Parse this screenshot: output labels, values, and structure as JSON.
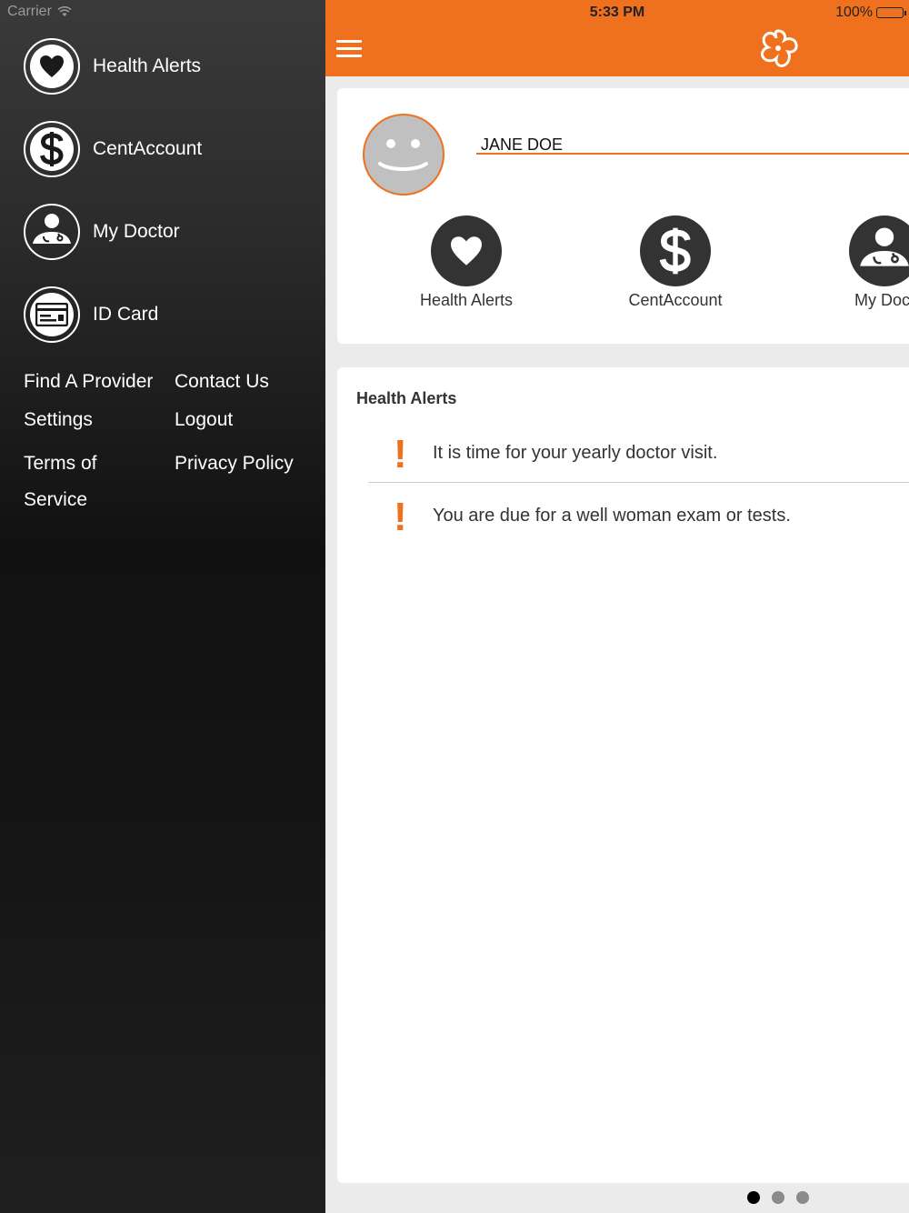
{
  "status_bar": {
    "carrier": "Carrier",
    "time": "5:33 PM",
    "battery": "100%"
  },
  "sidebar": {
    "items": [
      {
        "label": "Health Alerts",
        "icon": "heart-icon"
      },
      {
        "label": "CentAccount",
        "icon": "dollar-icon"
      },
      {
        "label": "My Doctor",
        "icon": "doctor-icon"
      },
      {
        "label": "ID Card",
        "icon": "id-card-icon"
      }
    ],
    "links": {
      "find_provider": "Find A Provider",
      "contact_us": "Contact Us",
      "settings": "Settings",
      "logout": "Logout",
      "terms_line1": "Terms of",
      "terms_line2": "Service",
      "privacy": "Privacy Policy"
    }
  },
  "header": {
    "menu_icon": "hamburger-icon",
    "logo_icon": "flower-logo-icon",
    "accent": "#f0711d"
  },
  "profile": {
    "name": "JANE DOE",
    "quick_actions": [
      {
        "label": "Health Alerts",
        "icon": "heart-icon"
      },
      {
        "label": "CentAccount",
        "icon": "dollar-icon"
      },
      {
        "label": "My Doct",
        "icon": "doctor-icon"
      }
    ]
  },
  "alerts": {
    "title": "Health Alerts",
    "items": [
      {
        "text": "It is time for your yearly doctor visit."
      },
      {
        "text": "You are due for a well woman exam or tests."
      }
    ]
  },
  "pager": {
    "pages": 3,
    "current": 1
  }
}
